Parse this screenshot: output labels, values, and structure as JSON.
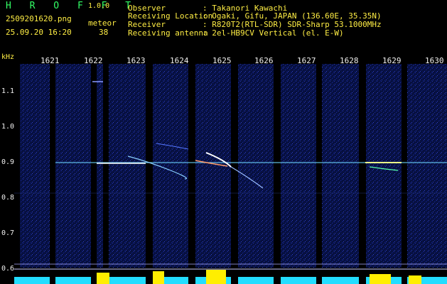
{
  "header": {
    "app_title": "H R O F F T",
    "app_version": "1.0.0",
    "filename": "2509201620.png",
    "datetime": "25.09.20 16:20",
    "meteor_label": "meteor",
    "meteor_count": "38"
  },
  "info": [
    {
      "key": "Observer",
      "value": ": Takanori Kawachi"
    },
    {
      "key": "Receiving Location",
      "value": ": Ogaki, Gifu, JAPAN (136.60E, 35.35N)"
    },
    {
      "key": "Receiver",
      "value": ": R820T2(RTL-SDR) SDR-Sharp 53.1000MHz"
    },
    {
      "key": "Receiving antenna",
      "value": ": 2el-HB9CV Vertical (el. E-W)"
    }
  ],
  "axis": {
    "y_unit": "kHz",
    "y_ticks": [
      "1.1",
      "1.0",
      "0.9",
      "0.8",
      "0.7",
      "0.6"
    ],
    "x_ticks": [
      "1621",
      "1622",
      "1623",
      "1624",
      "1625",
      "1626",
      "1627",
      "1628",
      "1629",
      "1630"
    ]
  },
  "colors": {
    "header_green": "#33ff66",
    "header_yellow": "#ffee44",
    "tick_white": "#f0f0f0",
    "background": "#000000",
    "noise_blue": "#0a1a66",
    "signal_cyan": "#88ffff",
    "bottom_cyan": "#22ddff",
    "bottom_yellow": "#ffee00"
  }
}
